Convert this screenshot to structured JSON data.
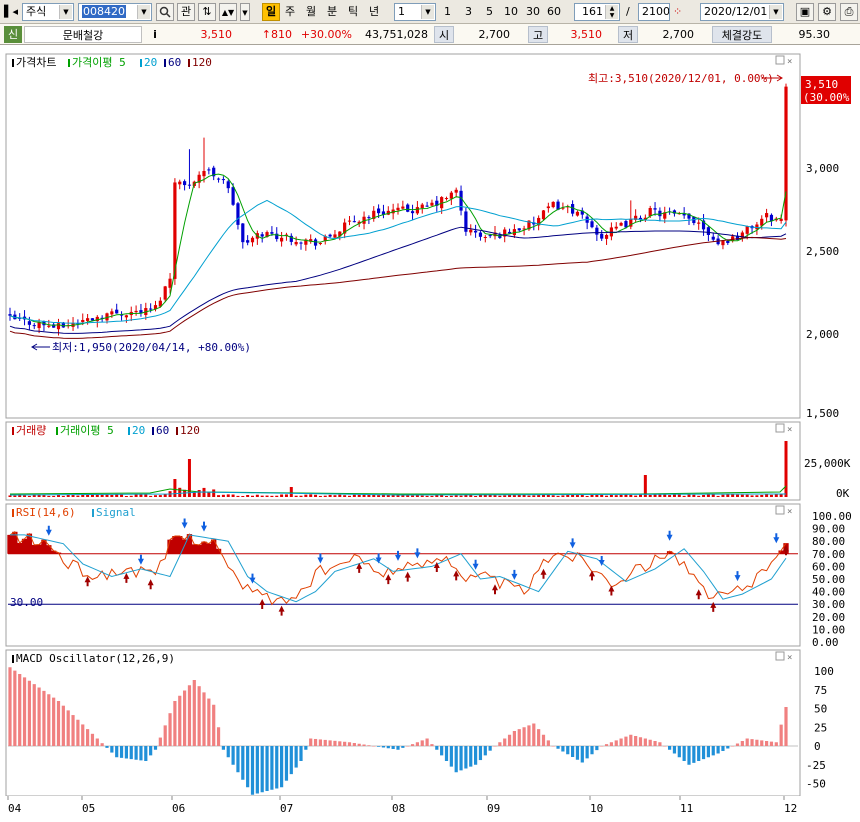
{
  "toolbar": {
    "market": "주식",
    "code": "008420",
    "buttons": [
      "관"
    ],
    "period_active": "일",
    "periods": [
      "주",
      "월",
      "분",
      "틱",
      "년"
    ],
    "multiplier": "1",
    "quick": [
      "1",
      "3",
      "5",
      "10",
      "30",
      "60"
    ],
    "count": "161",
    "separator": "/",
    "total": "2100",
    "date": "2020/12/01"
  },
  "quote": {
    "badge": "신",
    "name": "문배철강",
    "info": "i",
    "price": "3,510",
    "change": "↑810",
    "rate": "+30.00%",
    "volume": "43,751,028",
    "open_label": "시",
    "open": "2,700",
    "high_label": "고",
    "high": "3,510",
    "low_label": "저",
    "low": "2,700",
    "strength_label": "체결강도",
    "strength": "95.30"
  },
  "panels": {
    "price": {
      "legend": [
        {
          "text": "가격차트",
          "color": "#000000"
        },
        {
          "text": "가격이평 5",
          "color": "#00a000"
        },
        {
          "text": "20",
          "color": "#00a0d0"
        },
        {
          "text": "60",
          "color": "#000080"
        },
        {
          "text": "120",
          "color": "#800000"
        }
      ],
      "high_note": "최고:3,510(2020/12/01, 0.00%)",
      "low_note": "최저:1,950(2020/04/14, +80.00%)",
      "last_price": "3,510",
      "last_rate": "(30.00%)",
      "ylabels": [
        "3,000",
        "2,500",
        "2,000",
        "1,500"
      ]
    },
    "volume": {
      "legend": [
        {
          "text": "거래량",
          "color": "#c00000"
        },
        {
          "text": "거래이평 5",
          "color": "#00a000"
        },
        {
          "text": "20",
          "color": "#00a0d0"
        },
        {
          "text": "60",
          "color": "#000080"
        },
        {
          "text": "120",
          "color": "#800000"
        }
      ],
      "ylabels": [
        "25,000K",
        "0K"
      ]
    },
    "rsi": {
      "legend": [
        {
          "text": "RSI(14,6)",
          "color": "#e04000"
        },
        {
          "text": "Signal",
          "color": "#20a0d0"
        }
      ],
      "level_label": "30.00",
      "ylabels": [
        "100.00",
        "90.00",
        "80.00",
        "70.00",
        "60.00",
        "50.00",
        "40.00",
        "30.00",
        "20.00",
        "10.00",
        "0.00"
      ]
    },
    "macd": {
      "legend": [
        {
          "text": "MACD Oscillator(12,26,9)",
          "color": "#000000"
        }
      ],
      "ylabels": [
        "100",
        "75",
        "50",
        "25",
        "0",
        "-25",
        "-50"
      ]
    }
  },
  "xaxis": [
    "04",
    "05",
    "06",
    "07",
    "08",
    "09",
    "10",
    "11",
    "12"
  ],
  "colors": {
    "up": "#e00000",
    "down": "#0000d0",
    "ma5": "#00a000",
    "ma20": "#00a0d0",
    "ma60": "#000080",
    "ma120": "#800000",
    "osc_pos": "#f08080",
    "osc_neg": "#2090d8"
  }
}
